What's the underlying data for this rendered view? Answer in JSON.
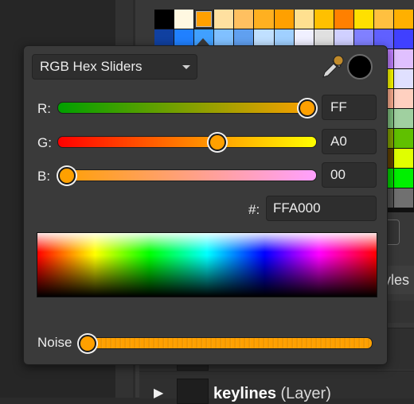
{
  "picker": {
    "mode": "RGB Hex Sliders",
    "channels": [
      {
        "label": "R:",
        "value": "FF",
        "fraction": 1.0,
        "gradient": [
          "#00a000",
          "#ffa000"
        ]
      },
      {
        "label": "G:",
        "value": "A0",
        "fraction": 0.627,
        "gradient": [
          "#ff0000",
          "#ffff00"
        ]
      },
      {
        "label": "B:",
        "value": "00",
        "fraction": 0.0,
        "gradient": [
          "#ffa000",
          "#ffa0ff"
        ]
      }
    ],
    "hex_label": "#:",
    "hex_value": "FFA000",
    "noise_label": "Noise",
    "noise_fraction": 0.0,
    "current_color": "#000000",
    "knob_color": "#ffa000"
  },
  "background": {
    "tab_text": "yles",
    "layer_name": "keylines",
    "layer_type": "(Layer)"
  },
  "swatches": [
    "#000000",
    "#fff8e1",
    "#ffa000",
    "#ffe0a0",
    "#ffc060",
    "#ffb020",
    "#ffa000",
    "#ffe090",
    "#ffc000",
    "#ff8000",
    "#ffe000",
    "#ffc040",
    "#ffb000",
    "#1040a0",
    "#2080ff",
    "#40a0ff",
    "#80c0ff",
    "#60a0f0",
    "#c0e0ff",
    "#a0d0ff",
    "#f0f0ff",
    "#e0e0e0",
    "#d0d0ff",
    "#8080ff",
    "#6060ff",
    "#4040ff",
    "#20c0ff",
    "#00d0ff",
    "#40e0ff",
    "#80f0ff",
    "#a0ffff",
    "#c0ffff",
    "#e0ffff",
    "#ffffff",
    "#f0f8ff",
    "#e0f0ff",
    "#a040ff",
    "#c080ff",
    "#e0c0ff",
    "#ff00ff",
    "#ff40c0",
    "#ff80e0",
    "#ffc0f0",
    "#00ffff",
    "#20e0e0",
    "#40c0c0",
    "#60a0a0",
    "#80ffff",
    "#00e0ff",
    "#40ff40",
    "#ffff00",
    "#e0e0ff",
    "#c0c0ff",
    "#ff4000",
    "#ff6020",
    "#ff8040",
    "#e04020",
    "#c02000",
    "#ff2000",
    "#ffa080",
    "#ffc0a0",
    "#d04010",
    "#ff8060",
    "#ffb090",
    "#ffd0c0",
    "#ffe0d0",
    "#40a040",
    "#60c060",
    "#80e080",
    "#a0ffa0",
    "#c0ffc0",
    "#e0ffe0",
    "#208020",
    "#40c040",
    "#60ff60",
    "#00a000",
    "#80c080",
    "#a0d0a0",
    "#c0e0c0",
    "#80c000",
    "#a0e000",
    "#c0ff00",
    "#e0ff40",
    "#ffff80",
    "#ffffc0",
    "#c0c000",
    "#e0e000",
    "#f0f060",
    "#a0a000",
    "#80a000",
    "#60c000",
    "#40a000",
    "#ffff00",
    "#ffe000",
    "#ffc000",
    "#ffa000",
    "#ff8000",
    "#ff6000",
    "#e0c000",
    "#c0a000",
    "#a08000",
    "#806000",
    "#604000",
    "#e0ff00",
    "#c0e000",
    "#20a020",
    "#40c020",
    "#60e040",
    "#80ff60",
    "#a0ff80",
    "#30b030",
    "#50d050",
    "#70f070",
    "#009000",
    "#00b000",
    "#00d000",
    "#00f000",
    "#90ff90",
    "#000000",
    "#202020",
    "#404040",
    "#606060",
    "#808080",
    "#a0a0a0",
    "#c0c0c0",
    "#e0e0e0",
    "#ffffff",
    "#303030",
    "#505050",
    "#707070",
    "#909090"
  ]
}
